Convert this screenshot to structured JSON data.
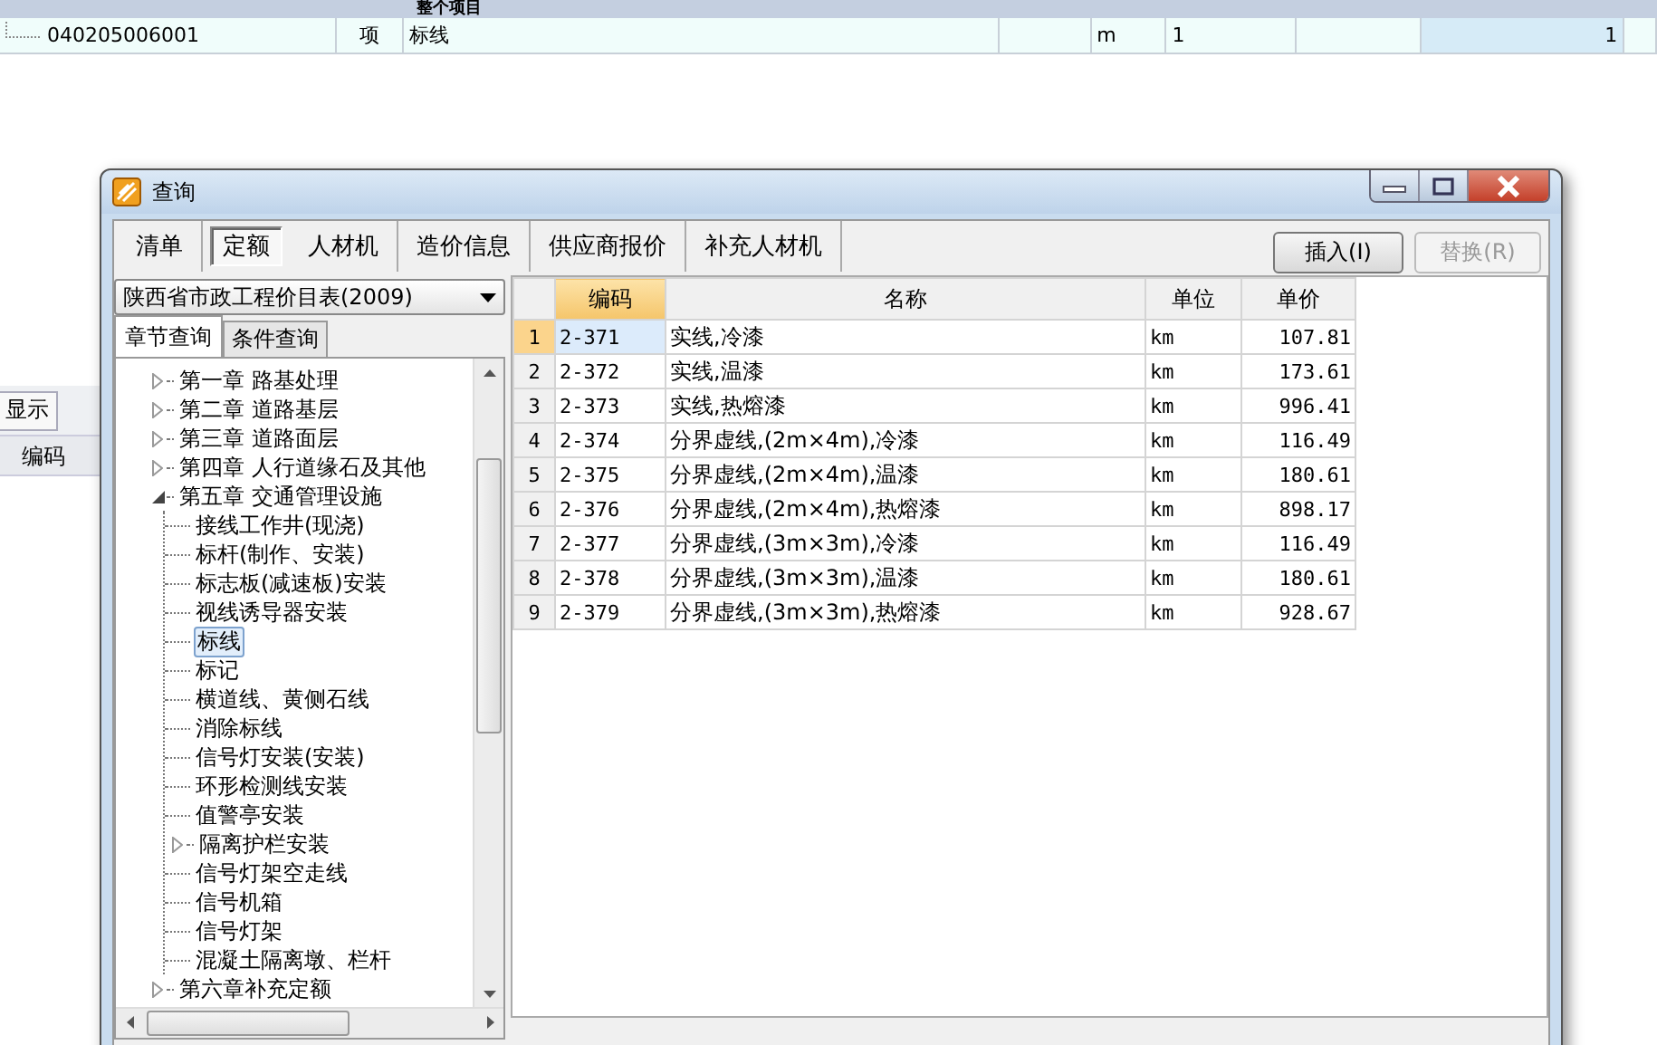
{
  "background_app": {
    "header": "整个项目",
    "row": {
      "code": "040205006001",
      "type": "项",
      "name": "标线",
      "unit": "m",
      "quantity": "1",
      "value": "1"
    },
    "toolbar_button": "显示",
    "table_header": "编码"
  },
  "dialog": {
    "title": "查询",
    "tabs": [
      {
        "label": "清单",
        "selected": false
      },
      {
        "label": "定额",
        "selected": true
      },
      {
        "label": "人材机",
        "selected": false
      },
      {
        "label": "造价信息",
        "selected": false
      },
      {
        "label": "供应商报价",
        "selected": false
      },
      {
        "label": "补充人材机",
        "selected": false
      }
    ],
    "buttons": [
      {
        "label": "插入(I)",
        "disabled": false
      },
      {
        "label": "替换(R)",
        "disabled": true
      }
    ],
    "library": "陕西省市政工程价目表(2009)",
    "search_tabs": [
      {
        "label": "章节查询",
        "selected": true
      },
      {
        "label": "条件查询",
        "selected": false
      }
    ],
    "tree": [
      {
        "label": "第一章 路基处理",
        "kind": "group",
        "expanded": false,
        "selected": false
      },
      {
        "label": "第二章 道路基层",
        "kind": "group",
        "expanded": false,
        "selected": false
      },
      {
        "label": "第三章 道路面层",
        "kind": "group",
        "expanded": false,
        "selected": false
      },
      {
        "label": "第四章 人行道缘石及其他",
        "kind": "group",
        "expanded": false,
        "selected": false
      },
      {
        "label": "第五章 交通管理设施",
        "kind": "group",
        "expanded": true,
        "selected": false,
        "children": [
          {
            "label": "接线工作井(现浇)",
            "kind": "item",
            "selected": false
          },
          {
            "label": "标杆(制作、安装)",
            "kind": "item",
            "selected": false
          },
          {
            "label": "标志板(减速板)安装",
            "kind": "item",
            "selected": false
          },
          {
            "label": "视线诱导器安装",
            "kind": "item",
            "selected": false
          },
          {
            "label": "标线",
            "kind": "item",
            "selected": true
          },
          {
            "label": "标记",
            "kind": "item",
            "selected": false
          },
          {
            "label": "横道线、黄侧石线",
            "kind": "item",
            "selected": false
          },
          {
            "label": "消除标线",
            "kind": "item",
            "selected": false
          },
          {
            "label": "信号灯安装(安装)",
            "kind": "item",
            "selected": false
          },
          {
            "label": "环形检测线安装",
            "kind": "item",
            "selected": false
          },
          {
            "label": "值警亭安装",
            "kind": "item",
            "selected": false
          },
          {
            "label": "隔离护栏安装",
            "kind": "group",
            "expanded": false,
            "selected": false
          },
          {
            "label": "信号灯架空走线",
            "kind": "item",
            "selected": false
          },
          {
            "label": "信号机箱",
            "kind": "item",
            "selected": false
          },
          {
            "label": "信号灯架",
            "kind": "item",
            "selected": false
          },
          {
            "label": "混凝土隔离墩、栏杆",
            "kind": "item",
            "selected": false
          }
        ]
      },
      {
        "label": "第六章补充定额",
        "kind": "group",
        "expanded": false,
        "selected": false
      }
    ],
    "table": {
      "columns": [
        {
          "label": "编码",
          "selected": true
        },
        {
          "label": "名称",
          "selected": false
        },
        {
          "label": "单位",
          "selected": false
        },
        {
          "label": "单价",
          "selected": false
        }
      ],
      "rows": [
        {
          "number": "1",
          "code": "2-371",
          "name": "实线,冷漆",
          "unit": "km",
          "price": "107.81",
          "selected": true
        },
        {
          "number": "2",
          "code": "2-372",
          "name": "实线,温漆",
          "unit": "km",
          "price": "173.61",
          "selected": false
        },
        {
          "number": "3",
          "code": "2-373",
          "name": "实线,热熔漆",
          "unit": "km",
          "price": "996.41",
          "selected": false
        },
        {
          "number": "4",
          "code": "2-374",
          "name": "分界虚线,(2m×4m),冷漆",
          "unit": "km",
          "price": "116.49",
          "selected": false
        },
        {
          "number": "5",
          "code": "2-375",
          "name": "分界虚线,(2m×4m),温漆",
          "unit": "km",
          "price": "180.61",
          "selected": false
        },
        {
          "number": "6",
          "code": "2-376",
          "name": "分界虚线,(2m×4m),热熔漆",
          "unit": "km",
          "price": "898.17",
          "selected": false
        },
        {
          "number": "7",
          "code": "2-377",
          "name": "分界虚线,(3m×3m),冷漆",
          "unit": "km",
          "price": "116.49",
          "selected": false
        },
        {
          "number": "8",
          "code": "2-378",
          "name": "分界虚线,(3m×3m),温漆",
          "unit": "km",
          "price": "180.61",
          "selected": false
        },
        {
          "number": "9",
          "code": "2-379",
          "name": "分界虚线,(3m×3m),热熔漆",
          "unit": "km",
          "price": "928.67",
          "selected": false
        }
      ]
    }
  }
}
